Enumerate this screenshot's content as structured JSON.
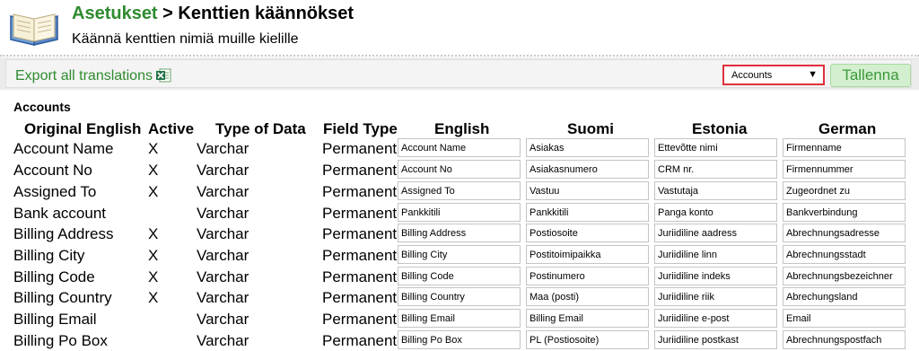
{
  "header": {
    "breadcrumb_parent": "Asetukset",
    "breadcrumb_separator": ">",
    "breadcrumb_current": "Kenttien käännökset",
    "subtitle": "Käännä kenttien nimiä muille kielille"
  },
  "toolbar": {
    "export_label": "Export all translations",
    "module_selected": "Accounts",
    "save_label": "Tallenna"
  },
  "section_title": "Accounts",
  "columns": [
    "Original English",
    "Active",
    "Type of Data",
    "Field Type",
    "English",
    "Suomi",
    "Estonia",
    "German"
  ],
  "rows": [
    {
      "original": "Account Name",
      "active": "X",
      "type": "Varchar",
      "field_type": "Permanent",
      "en": "Account Name",
      "fi": "Asiakas",
      "et": "Ettevõtte nimi",
      "de": "Firmenname"
    },
    {
      "original": "Account No",
      "active": "X",
      "type": "Varchar",
      "field_type": "Permanent",
      "en": "Account No",
      "fi": "Asiakasnumero",
      "et": "CRM nr.",
      "de": "Firmennummer"
    },
    {
      "original": "Assigned To",
      "active": "X",
      "type": "Varchar",
      "field_type": "Permanent",
      "en": "Assigned To",
      "fi": "Vastuu",
      "et": "Vastutaja",
      "de": "Zugeordnet zu"
    },
    {
      "original": "Bank account",
      "active": "",
      "type": "Varchar",
      "field_type": "Permanent",
      "en": "Pankkitili",
      "fi": "Pankkitili",
      "et": "Panga konto",
      "de": "Bankverbindung"
    },
    {
      "original": "Billing Address",
      "active": "X",
      "type": "Varchar",
      "field_type": "Permanent",
      "en": "Billing Address",
      "fi": "Postiosoite",
      "et": "Juriidiline aadress",
      "de": "Abrechnungsadresse"
    },
    {
      "original": "Billing City",
      "active": "X",
      "type": "Varchar",
      "field_type": "Permanent",
      "en": "Billing City",
      "fi": "Postitoimipaikka",
      "et": "Juriidiline linn",
      "de": "Abrechnungsstadt"
    },
    {
      "original": "Billing Code",
      "active": "X",
      "type": "Varchar",
      "field_type": "Permanent",
      "en": "Billing Code",
      "fi": "Postinumero",
      "et": "Juriidiline indeks",
      "de": "Abrechnungsbezeichner"
    },
    {
      "original": "Billing Country",
      "active": "X",
      "type": "Varchar",
      "field_type": "Permanent",
      "en": "Billing Country",
      "fi": "Maa (posti)",
      "et": "Juriidiline riik",
      "de": "Abrechungsland"
    },
    {
      "original": "Billing Email",
      "active": "",
      "type": "Varchar",
      "field_type": "Permanent",
      "en": "Billing Email",
      "fi": "Billing Email",
      "et": "Juriidiline e-post",
      "de": "Email"
    },
    {
      "original": "Billing Po Box",
      "active": "",
      "type": "Varchar",
      "field_type": "Permanent",
      "en": "Billing Po Box",
      "fi": "PL (Postiosoite)",
      "et": "Juriidiline postkast",
      "de": "Abrechnungspostfach"
    }
  ],
  "colors": {
    "accent_green": "#2e8b2e",
    "highlight_red": "#e0303a",
    "save_bg": "#d4efcf"
  },
  "icons": {
    "logo": "open-book-icon",
    "export": "excel-icon",
    "select_arrow": "triangle-down"
  }
}
